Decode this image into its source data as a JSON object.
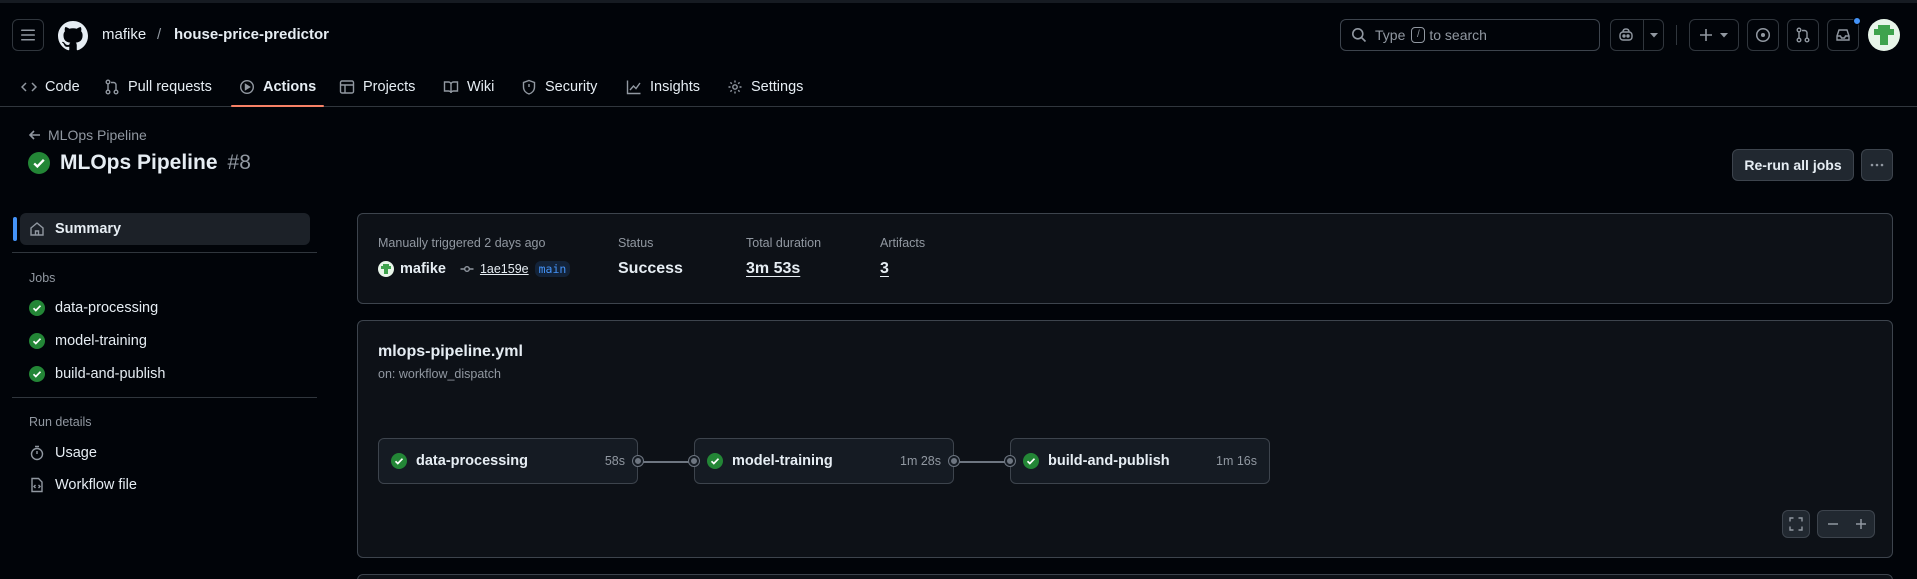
{
  "header": {
    "owner": "mafike",
    "separator": "/",
    "repo": "house-price-predictor",
    "search_prefix": "Type",
    "search_key": "/",
    "search_suffix": "to search"
  },
  "tabs": [
    {
      "label": "Code",
      "icon": "code-icon"
    },
    {
      "label": "Pull requests",
      "icon": "git-pull-request-icon"
    },
    {
      "label": "Actions",
      "icon": "play-icon",
      "active": true
    },
    {
      "label": "Projects",
      "icon": "table-icon"
    },
    {
      "label": "Wiki",
      "icon": "book-icon"
    },
    {
      "label": "Security",
      "icon": "shield-icon"
    },
    {
      "label": "Insights",
      "icon": "graph-icon"
    },
    {
      "label": "Settings",
      "icon": "gear-icon"
    }
  ],
  "run": {
    "back_label": "MLOps Pipeline",
    "title": "MLOps Pipeline",
    "number": "#8",
    "rerun_label": "Re-run all jobs"
  },
  "sidebar": {
    "summary_label": "Summary",
    "jobs_heading": "Jobs",
    "jobs": [
      "data-processing",
      "model-training",
      "build-and-publish"
    ],
    "run_details_heading": "Run details",
    "usage_label": "Usage",
    "workflow_file_label": "Workflow file"
  },
  "summary": {
    "trigger_text": "Manually triggered 2 days ago",
    "actor": "mafike",
    "commit": "1ae159e",
    "branch": "main",
    "status_label": "Status",
    "status_value": "Success",
    "duration_label": "Total duration",
    "duration_value": "3m 53s",
    "artifacts_label": "Artifacts",
    "artifacts_value": "3"
  },
  "workflow": {
    "file_name": "mlops-pipeline.yml",
    "trigger": "on: workflow_dispatch",
    "jobs": [
      {
        "name": "data-processing",
        "duration": "58s"
      },
      {
        "name": "model-training",
        "duration": "1m 28s"
      },
      {
        "name": "build-and-publish",
        "duration": "1m 16s"
      }
    ]
  },
  "colors": {
    "success": "#238636",
    "accent": "#4493f8",
    "active_tab_underline": "#f78166"
  }
}
